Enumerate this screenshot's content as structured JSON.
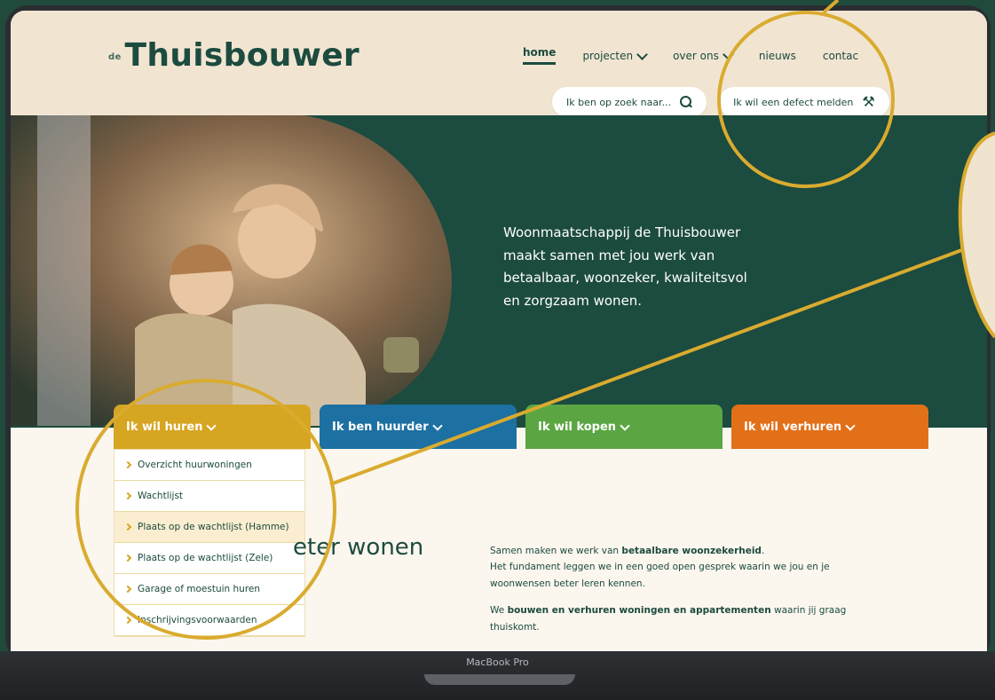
{
  "device": {
    "label": "MacBook Pro"
  },
  "logo": {
    "prefix": "de",
    "text": "Thuisbouwer"
  },
  "nav": {
    "items": [
      {
        "label": "home",
        "active": true,
        "dropdown": false
      },
      {
        "label": "projecten",
        "active": false,
        "dropdown": true
      },
      {
        "label": "over ons",
        "active": false,
        "dropdown": true
      },
      {
        "label": "nieuws",
        "active": false,
        "dropdown": false
      },
      {
        "label": "contac",
        "active": false,
        "dropdown": false
      }
    ]
  },
  "actions": {
    "search_label": "Ik ben op zoek naar...",
    "defect_label": "Ik wil een defect melden"
  },
  "hero": {
    "line1": "Woonmaatschappij de Thuisbouwer",
    "line2": "maakt samen met jou werk van",
    "line3": "betaalbaar, woonzeker, kwaliteitsvol",
    "line4": "en zorgzaam wonen."
  },
  "tabs": [
    {
      "label": "Ik wil huren",
      "color": "#d6a521"
    },
    {
      "label": "Ik ben huurder",
      "color": "#1d70a2"
    },
    {
      "label": "Ik wil kopen",
      "color": "#5ba643"
    },
    {
      "label": "Ik wil verhuren",
      "color": "#e27019"
    }
  ],
  "dropdown": {
    "items": [
      "Overzicht huurwoningen",
      "Wachtlijst",
      "Plaats op de wachtlijst (Hamme)",
      "Plaats op de wachtlijst (Zele)",
      "Garage of moestuin huren",
      "Inschrijvingsvoorwaarden"
    ]
  },
  "section": {
    "heading_partial": "eter wonen",
    "p1_a": "Samen maken we werk van ",
    "p1_b": "betaalbare woonzekerheid",
    "p1_c": ".",
    "p1_line2": "Het fundament leggen we in een goed open gesprek waarin we jou en je",
    "p1_line3": "woonwensen beter leren kennen.",
    "p2_a": "We ",
    "p2_b": "bouwen en verhuren woningen en appartementen",
    "p2_c": " waarin jij graag",
    "p2_line2": "thuiskomt."
  },
  "colors": {
    "brand_green": "#1c4b3f",
    "accent_gold": "#d6a521",
    "annotation": "#d9ab2f"
  }
}
